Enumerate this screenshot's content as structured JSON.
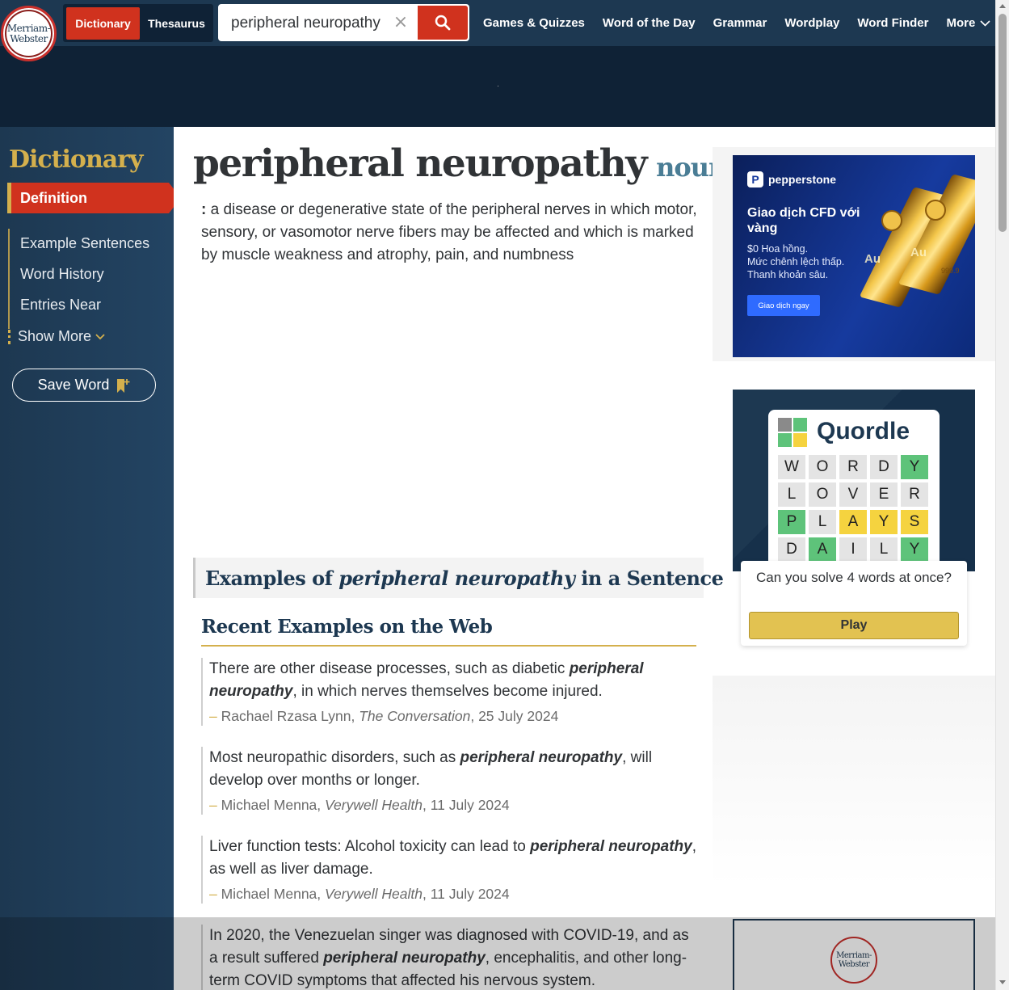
{
  "header": {
    "logo": [
      "Merriam-",
      "Webster"
    ],
    "tabs": {
      "dictionary": "Dictionary",
      "thesaurus": "Thesaurus"
    },
    "search": {
      "value": "peripheral neuropathy",
      "placeholder": ""
    },
    "nav": [
      "Games & Quizzes",
      "Word of the Day",
      "Grammar",
      "Wordplay",
      "Word Finder",
      "More"
    ]
  },
  "sidebar": {
    "title": "Dictionary",
    "active": "Definition",
    "items": [
      "Example Sentences",
      "Word History",
      "Entries Near"
    ],
    "show_more": "Show More",
    "save_word": "Save Word"
  },
  "entry": {
    "headword": "peripheral neuropathy",
    "pos": "noun",
    "definition_colon": ":",
    "definition": "a disease or degenerative state of the peripheral nerves in which motor, sensory, or vasomotor nerve fibers may be affected and which is marked by muscle weakness and atrophy, pain, and numbness"
  },
  "examples": {
    "heading_prefix": "Examples of",
    "heading_term": "peripheral neuropathy",
    "heading_suffix": "in a Sentence",
    "recent_heading": "Recent Examples on the Web",
    "items": [
      {
        "before": "There are other disease processes, such as diabetic ",
        "term": "peripheral neuropathy",
        "after": ", in which nerves themselves become injured.",
        "author": "Rachael Rzasa Lynn",
        "publication": "The Conversation",
        "date": "25 July 2024"
      },
      {
        "before": "Most neuropathic disorders, such as ",
        "term": "peripheral neuropathy",
        "after": ", will develop over months or longer.",
        "author": "Michael Menna",
        "publication": "Verywell Health",
        "date": "11 July 2024"
      },
      {
        "before": "Liver function tests: Alcohol toxicity can lead to ",
        "term": "peripheral neuropathy",
        "after": ", as well as liver damage.",
        "author": "Michael Menna",
        "publication": "Verywell Health",
        "date": "11 July 2024"
      },
      {
        "before": "In 2020, the Venezuelan singer was diagnosed with COVID-19, and as a result suffered ",
        "term": "peripheral neuropathy",
        "after": ", encephalitis, and other long-term COVID symptoms that affected his nervous system.",
        "author": "",
        "publication": "",
        "date": ""
      }
    ]
  },
  "ad_pepperstone": {
    "brand": "pepperstone",
    "headline": "Giao dịch CFD với vàng",
    "sub": [
      "$0 Hoa hồng.",
      "Mức chênh lệch thấp.",
      "Thanh khoản sâu."
    ],
    "cta": "Giao dịch ngay",
    "bar_labels": [
      "Au",
      "Au",
      "999.9"
    ]
  },
  "quordle": {
    "title": "Quordle",
    "rows": [
      [
        "W",
        "O",
        "R",
        "D",
        "Y"
      ],
      [
        "L",
        "O",
        "V",
        "E",
        "R"
      ],
      [
        "P",
        "L",
        "A",
        "Y",
        "S"
      ],
      [
        "D",
        "A",
        "I",
        "L",
        "Y"
      ]
    ],
    "colors": [
      [
        "n",
        "n",
        "n",
        "n",
        "g"
      ],
      [
        "n",
        "n",
        "n",
        "n",
        "n"
      ],
      [
        "g",
        "n",
        "y",
        "y",
        "y"
      ],
      [
        "n",
        "g",
        "n",
        "n",
        "g"
      ]
    ],
    "question": "Can you solve 4 words at once?",
    "play": "Play"
  },
  "ad_bottom_logo": [
    "Merriam-",
    "Webster"
  ],
  "colors": {
    "navy": "#1d3851",
    "red": "#d0321e",
    "gold": "#d4b04d",
    "quordle_green": "#5ec37a",
    "quordle_yellow": "#f5d33f"
  }
}
